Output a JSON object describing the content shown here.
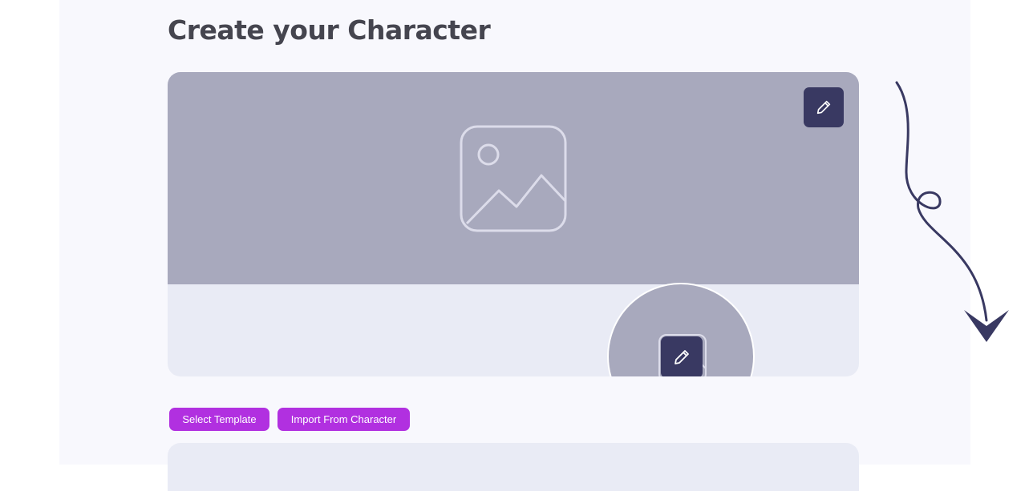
{
  "page": {
    "title": "Create your Character"
  },
  "banner": {
    "placeholder_icon": "image-placeholder-icon",
    "edit_icon": "pencil-icon"
  },
  "avatar": {
    "placeholder_icon": "image-placeholder-icon",
    "edit_icon": "pencil-icon"
  },
  "actions": {
    "select_template_label": "Select Template",
    "import_label": "Import From Character"
  },
  "colors": {
    "accent": "#b130e0",
    "edit_button": "#393962",
    "banner_bg": "#a8a9bd",
    "card_bg": "#e9ebf5",
    "title": "#45454f"
  }
}
